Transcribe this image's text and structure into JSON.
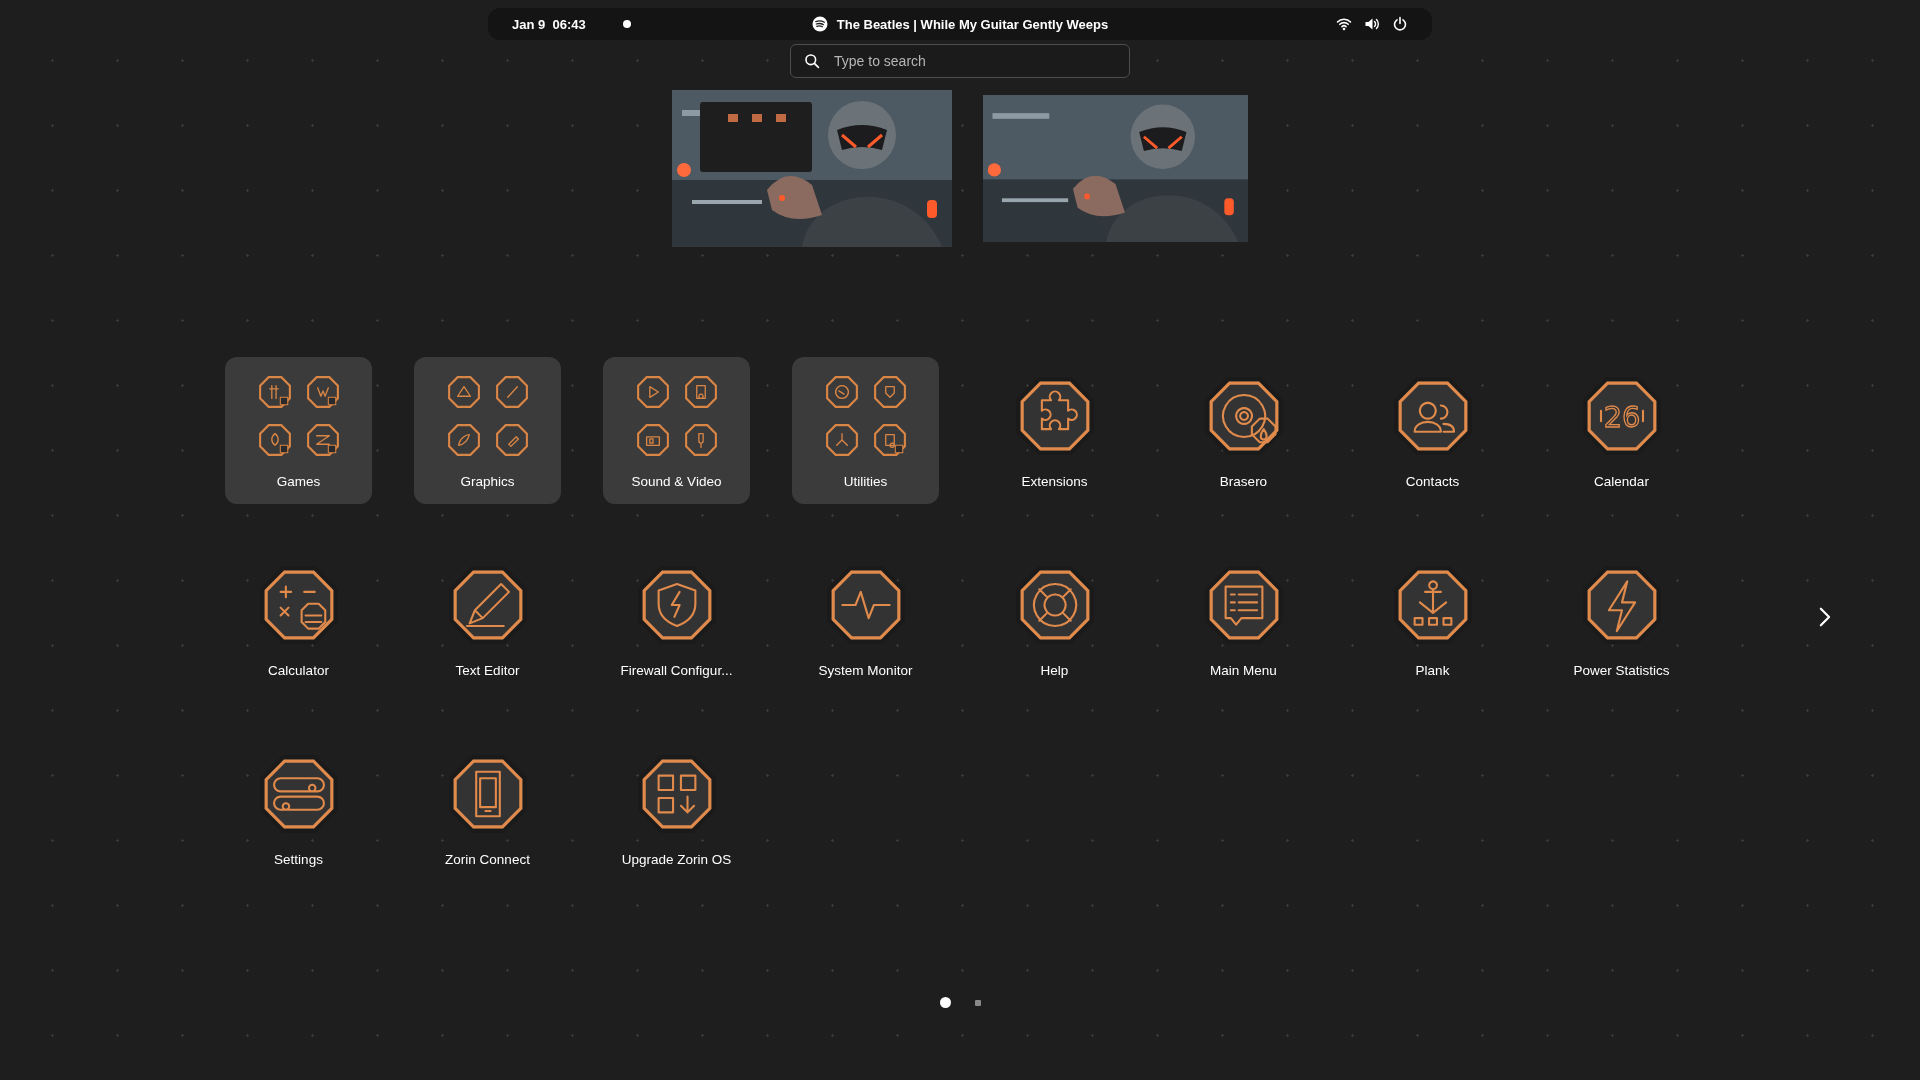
{
  "top_bar": {
    "datetime": "Jan 9  06:43",
    "notification_dot": true,
    "media_title": "The Beatles | While My Guitar Gently Weeps"
  },
  "search": {
    "placeholder": "Type to search"
  },
  "workspaces": [
    {
      "kind": "picture",
      "selected": true,
      "has_window": true
    },
    {
      "kind": "picture",
      "selected": false,
      "has_window": false
    }
  ],
  "apps": [
    {
      "kind": "folder",
      "label": "Games"
    },
    {
      "kind": "folder",
      "label": "Graphics"
    },
    {
      "kind": "folder",
      "label": "Sound & Video"
    },
    {
      "kind": "folder",
      "label": "Utilities"
    },
    {
      "kind": "app",
      "label": "Extensions"
    },
    {
      "kind": "app",
      "label": "Brasero"
    },
    {
      "kind": "app",
      "label": "Contacts"
    },
    {
      "kind": "app",
      "label": "Calendar",
      "icon_text": "26"
    },
    {
      "kind": "app",
      "label": "Calculator"
    },
    {
      "kind": "app",
      "label": "Text Editor"
    },
    {
      "kind": "app",
      "label": "Firewall Configur..."
    },
    {
      "kind": "app",
      "label": "System Monitor"
    },
    {
      "kind": "app",
      "label": "Help"
    },
    {
      "kind": "app",
      "label": "Main Menu"
    },
    {
      "kind": "app",
      "label": "Plank"
    },
    {
      "kind": "app",
      "label": "Power Statistics"
    },
    {
      "kind": "app",
      "label": "Settings"
    },
    {
      "kind": "app",
      "label": "Zorin Connect"
    },
    {
      "kind": "app",
      "label": "Upgrade Zorin OS"
    }
  ],
  "pages": [
    {
      "selected": true
    },
    {
      "selected": false
    }
  ]
}
